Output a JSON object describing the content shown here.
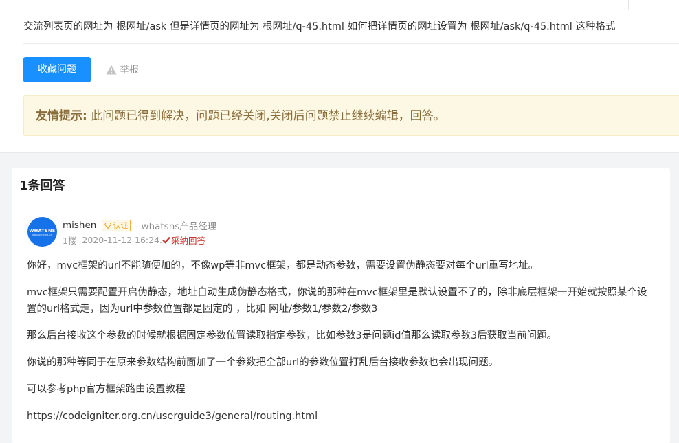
{
  "question": {
    "text": "交流列表页的网址为   根网址/ask    但是详情页的网址为   根网址/q-45.html   如何把详情页的网址设置为 根网址/ask/q-45.html  这种格式"
  },
  "actions": {
    "favorite_label": "收藏问题",
    "report_label": "举报"
  },
  "notice": {
    "label": "友情提示:",
    "text": " 此问题已得到解决，问题已经关闭,关闭后问题禁止继续编辑，回答。"
  },
  "answers": {
    "count_title": "1条回答",
    "items": [
      {
        "avatar_text": "WHATSNS",
        "avatar_sub": "問答中國最愛問答系統",
        "author": "mishen",
        "badge": "认证",
        "title": "- whatsns产品经理",
        "floor": "1楼",
        "date": " · 2020-11-12 16:24.",
        "adopted": "采纳回答",
        "paragraphs": [
          "你好，mvc框架的url不能随便加的，不像wp等非mvc框架，都是动态参数，需要设置伪静态要对每个url重写地址。",
          "mvc框架只需要配置开启伪静态，地址自动生成伪静态格式，你说的那种在mvc框架里是默认设置不了的，除非底层框架一开始就按照某个设置的url格式走，因为url中参数位置都是固定的 ，比如 网址/参数1/参数2/参数3",
          "那么后台接收这个参数的时候就根据固定参数位置读取指定参数，比如参数3是问题id值那么读取参数3后获取当前问题。",
          "你说的那种等同于在原来参数结构前面加了一个参数把全部url的参数位置打乱后台接收参数也会出现问题。",
          "可以参考php官方框架路由设置教程"
        ],
        "link": "https://codeigniter.org.cn/userguide3/general/routing.html"
      }
    ]
  },
  "colors": {
    "primary": "#1890ff",
    "notice_bg": "#fcf8e3",
    "notice_text": "#8a6d3b",
    "adopted": "#c9302c",
    "badge": "#f0a020",
    "avatar": "#1672e8"
  }
}
